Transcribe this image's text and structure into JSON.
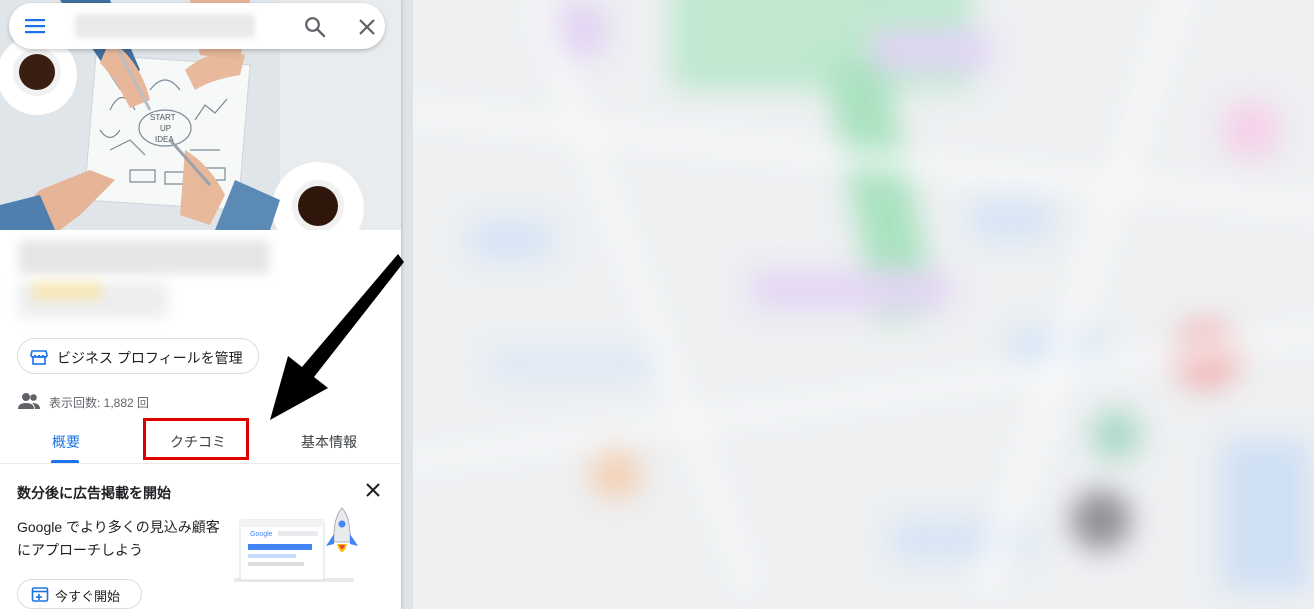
{
  "search": {
    "query": ""
  },
  "place": {
    "name": "",
    "manage_button_label": "ビジネス プロフィールを管理",
    "views_label": "表示回数: 1,882 回"
  },
  "tabs": [
    {
      "label": "概要",
      "selected": true
    },
    {
      "label": "クチコミ",
      "selected": false
    },
    {
      "label": "基本情報",
      "selected": false
    }
  ],
  "promo": {
    "title": "数分後に広告掲載を開始",
    "body_line1": "Google でより多くの見込み顧客",
    "body_line2": "にアプローチしよう",
    "start_button_label": "今すぐ開始",
    "illustration_text": "Google"
  },
  "hero_image": {
    "text": [
      "START",
      "UP",
      "IDEA"
    ]
  },
  "colors": {
    "accent": "#1a73e8",
    "highlight_box": "#e00000",
    "annotation_arrow": "#000000"
  },
  "icons": {
    "menu": "hamburger-menu-icon",
    "search": "search-icon",
    "close": "close-icon",
    "store": "storefront-icon",
    "people": "people-icon",
    "add_window": "add-to-window-icon"
  }
}
